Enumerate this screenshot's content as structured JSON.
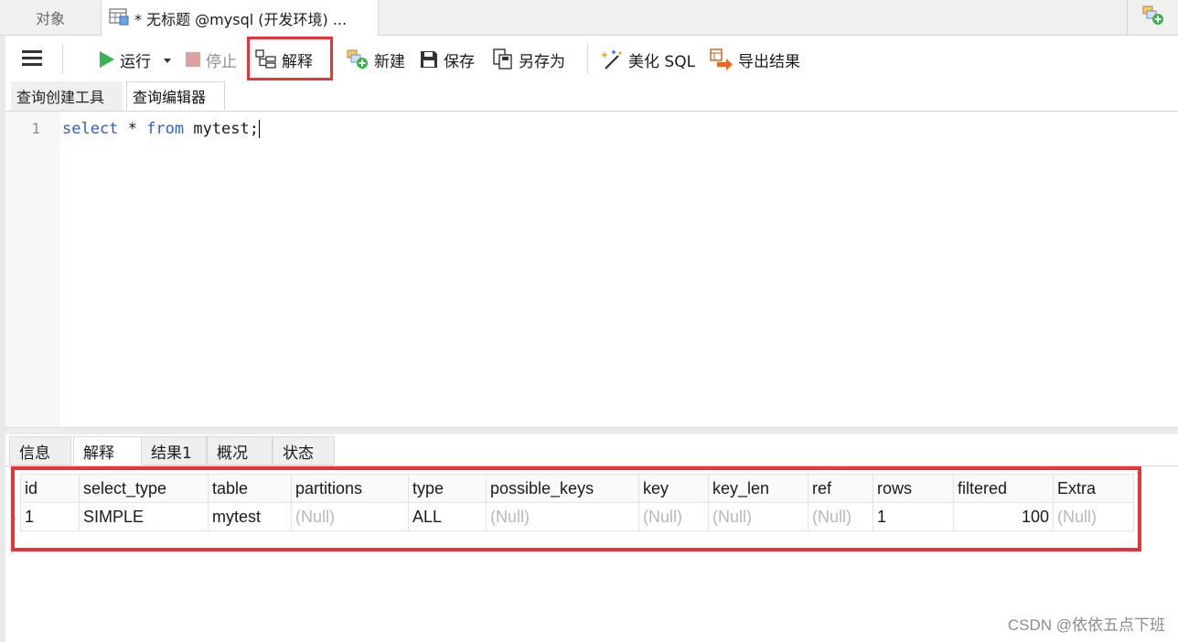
{
  "window": {
    "tabs": [
      {
        "label": "对象"
      },
      {
        "label": "* 无标题 @mysql (开发环境) ..."
      }
    ]
  },
  "toolbar": {
    "run_label": "运行",
    "stop_label": "停止",
    "explain_label": "解释",
    "new_label": "新建",
    "save_label": "保存",
    "save_as_label": "另存为",
    "beautify_label": "美化 SQL",
    "export_label": "导出结果"
  },
  "subtabs": [
    {
      "label": "查询创建工具"
    },
    {
      "label": "查询编辑器"
    }
  ],
  "editor": {
    "line_number": "1",
    "kw_select": "select",
    "star": " * ",
    "kw_from": "from",
    "rest": " mytest;"
  },
  "result_tabs": [
    {
      "label": "信息"
    },
    {
      "label": "解释"
    },
    {
      "label": "结果1"
    },
    {
      "label": "概况"
    },
    {
      "label": "状态"
    }
  ],
  "grid": {
    "columns": [
      "id",
      "select_type",
      "table",
      "partitions",
      "type",
      "possible_keys",
      "key",
      "key_len",
      "ref",
      "rows",
      "filtered",
      "Extra"
    ],
    "rows": [
      [
        "1",
        "SIMPLE",
        "mytest",
        "(Null)",
        "ALL",
        "(Null)",
        "(Null)",
        "(Null)",
        "(Null)",
        "1",
        "100",
        "(Null)"
      ]
    ]
  },
  "watermark": "CSDN @依依五点下班",
  "colors": {
    "highlight": "#e8333a",
    "keyword": "#2d5dc8",
    "null_text": "#b8b8b8"
  }
}
